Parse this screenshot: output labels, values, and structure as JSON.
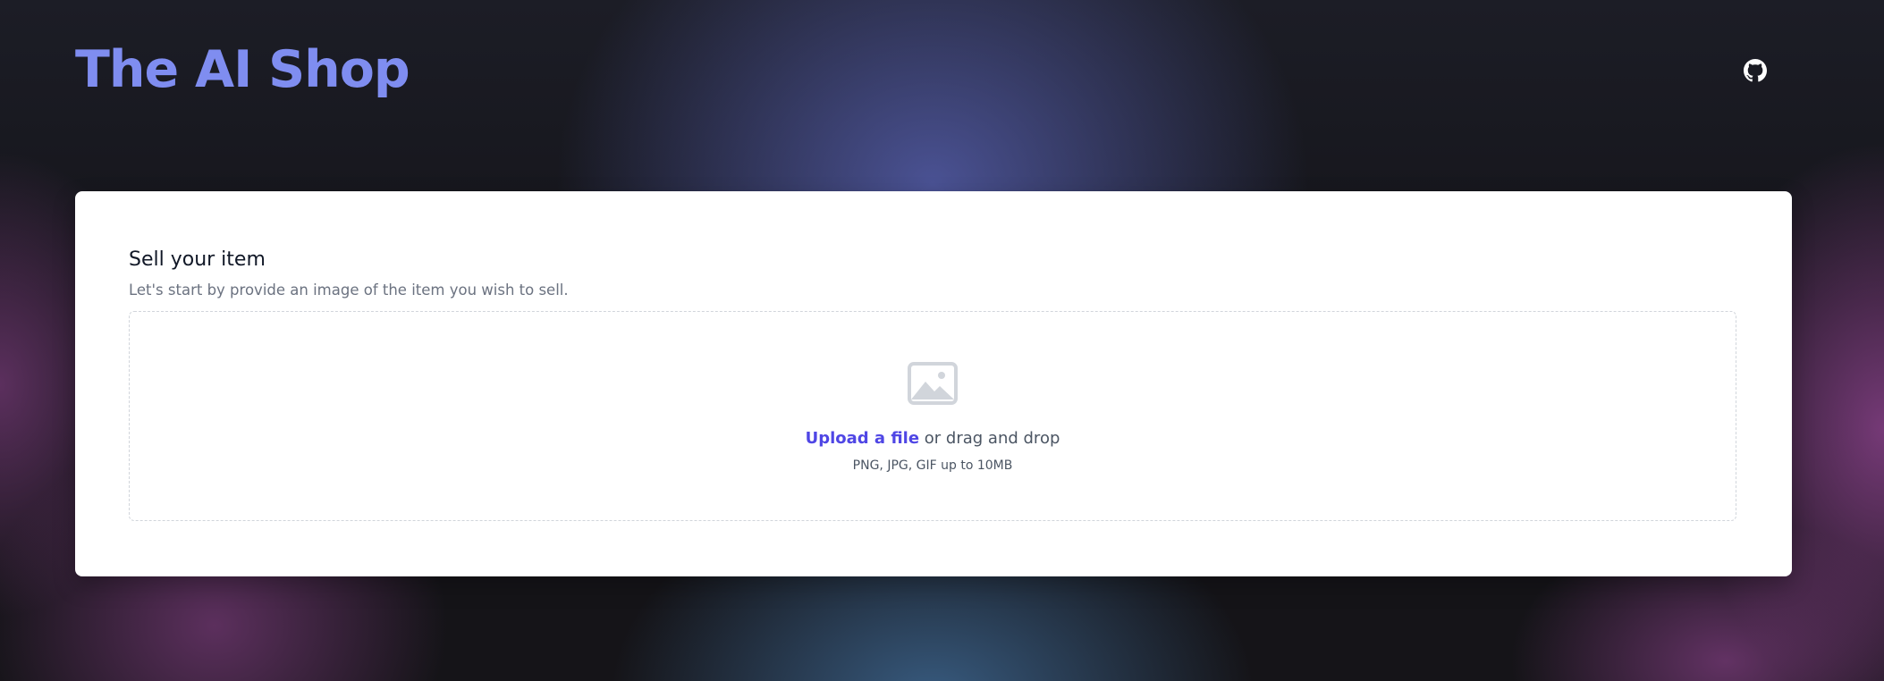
{
  "header": {
    "title": "The AI Shop",
    "github_icon": "github-icon"
  },
  "card": {
    "title": "Sell your item",
    "subtitle": "Let's start by provide an image of the item you wish to sell.",
    "dropzone": {
      "icon": "photo-icon",
      "upload_link": "Upload a file",
      "upload_suffix": " or drag and drop",
      "hint": "PNG, JPG, GIF up to 10MB"
    }
  },
  "colors": {
    "title": "#7f8df0",
    "accent_link": "#4f46e5",
    "card_background": "#ffffff",
    "page_background": "#151418"
  }
}
